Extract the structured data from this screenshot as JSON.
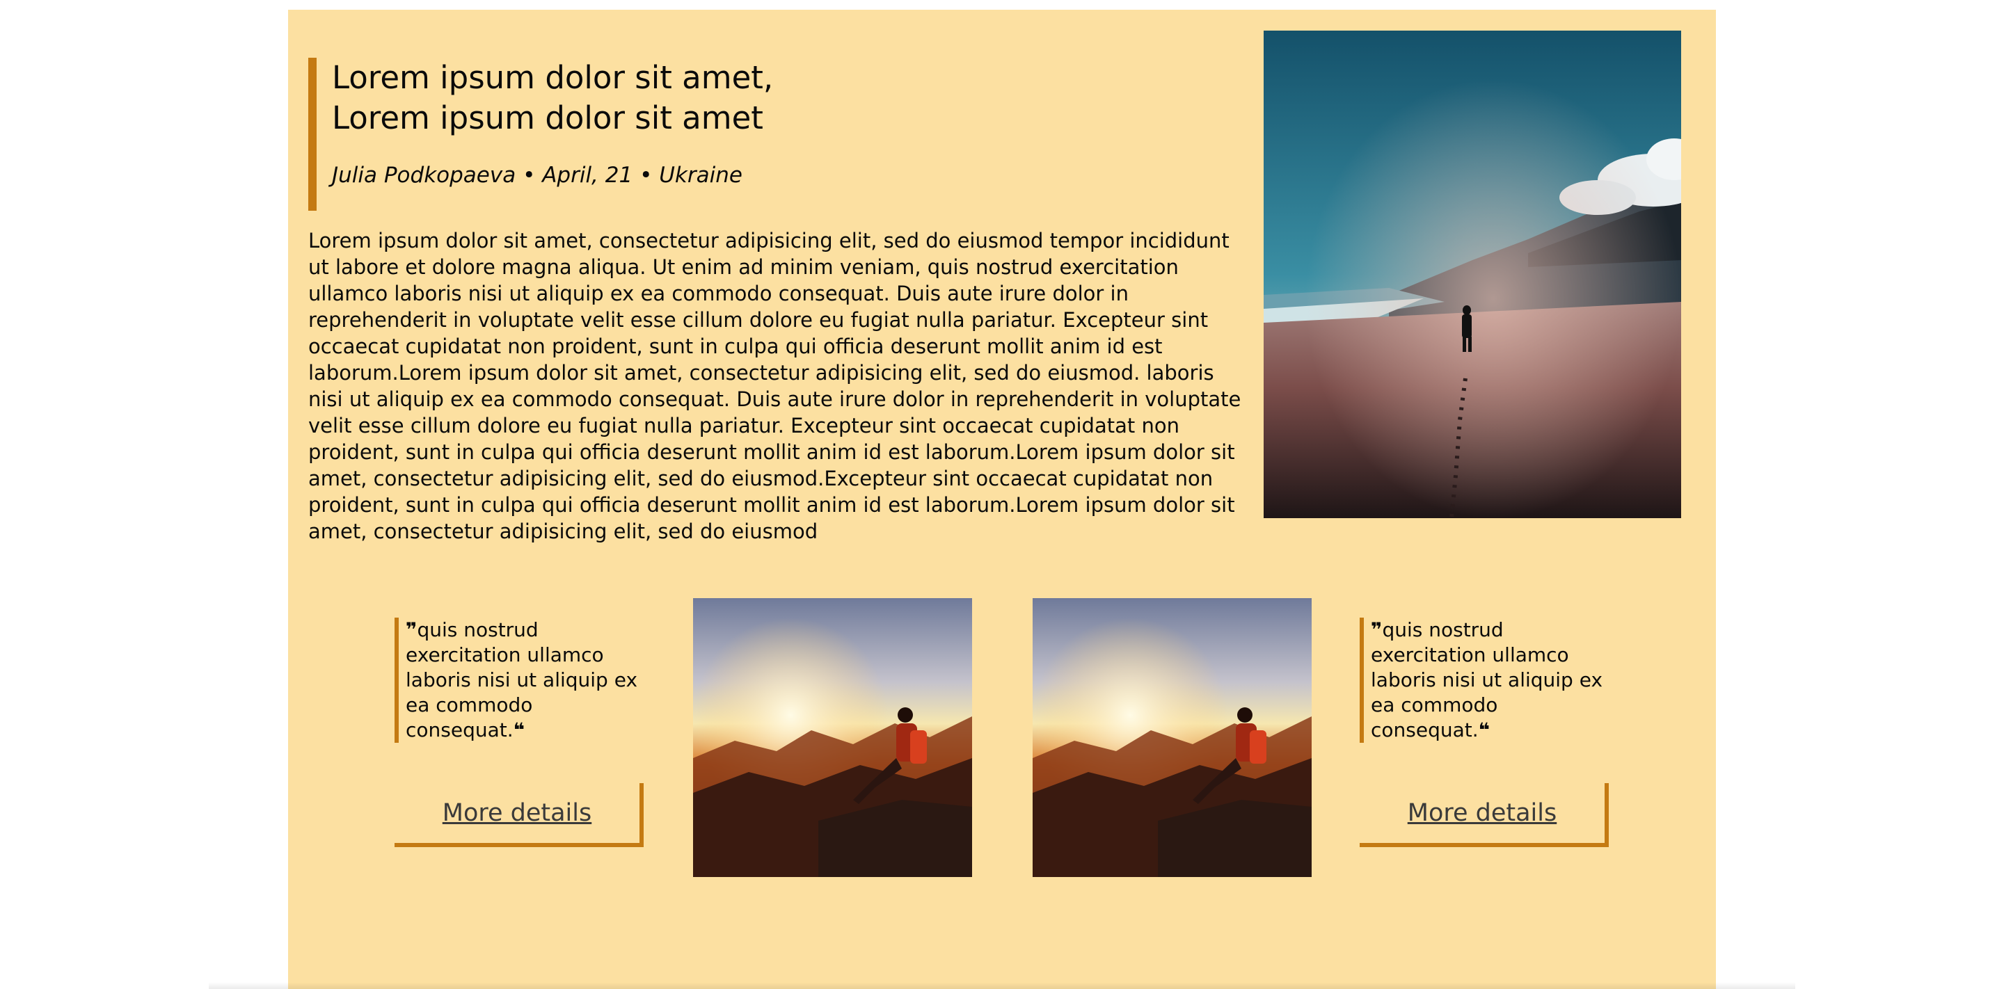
{
  "article": {
    "title_line1": "Lorem ipsum dolor sit amet,",
    "title_line2": "Lorem ipsum dolor sit amet",
    "byline": "Julia Podkopaeva • April, 21 • Ukraine",
    "body": "Lorem ipsum dolor sit amet, consectetur adipisicing elit, sed do eiusmod tempor incididunt ut labore et dolore magna aliqua. Ut enim ad minim veniam, quis nostrud exercitation ullamco laboris nisi ut aliquip ex ea commodo consequat. Duis aute irure dolor in reprehenderit in voluptate velit esse cillum dolore eu fugiat nulla pariatur. Excepteur sint occaecat cupidatat non proident, sunt in culpa qui officia deserunt mollit anim id est laborum.Lorem ipsum dolor sit amet, consectetur adipisicing elit, sed do eiusmod. laboris nisi ut aliquip ex ea commodo consequat. Duis aute irure dolor in reprehenderit in voluptate velit esse cillum dolore eu fugiat nulla pariatur. Excepteur sint occaecat cupidatat non proident, sunt in culpa qui officia deserunt mollit anim id est laborum.Lorem ipsum dolor sit amet, consectetur adipisicing elit, sed do eiusmod.Excepteur sint occaecat cupidatat non proident, sunt in culpa qui officia deserunt mollit anim id est laborum.Lorem ipsum dolor sit amet, consectetur adipisicing elit, sed do eiusmod"
  },
  "cards": [
    {
      "quote_open": "❞",
      "quote": "quis nostrud exercitation ullamco laboris nisi ut aliquip ex ea commodo consequat.",
      "quote_close": "❝",
      "button_label": "More details"
    },
    {
      "quote_open": "❞",
      "quote": "quis nostrud exercitation ullamco laboris nisi ut aliquip ex ea commodo consequat.",
      "quote_close": "❝",
      "button_label": "More details"
    }
  ],
  "colors": {
    "background": "#fce0a1",
    "accent": "#c47a12",
    "text": "#0a0a0a"
  },
  "icons": {
    "hero": "beach-walker-photo",
    "thumb": "sunset-hiker-photo"
  }
}
